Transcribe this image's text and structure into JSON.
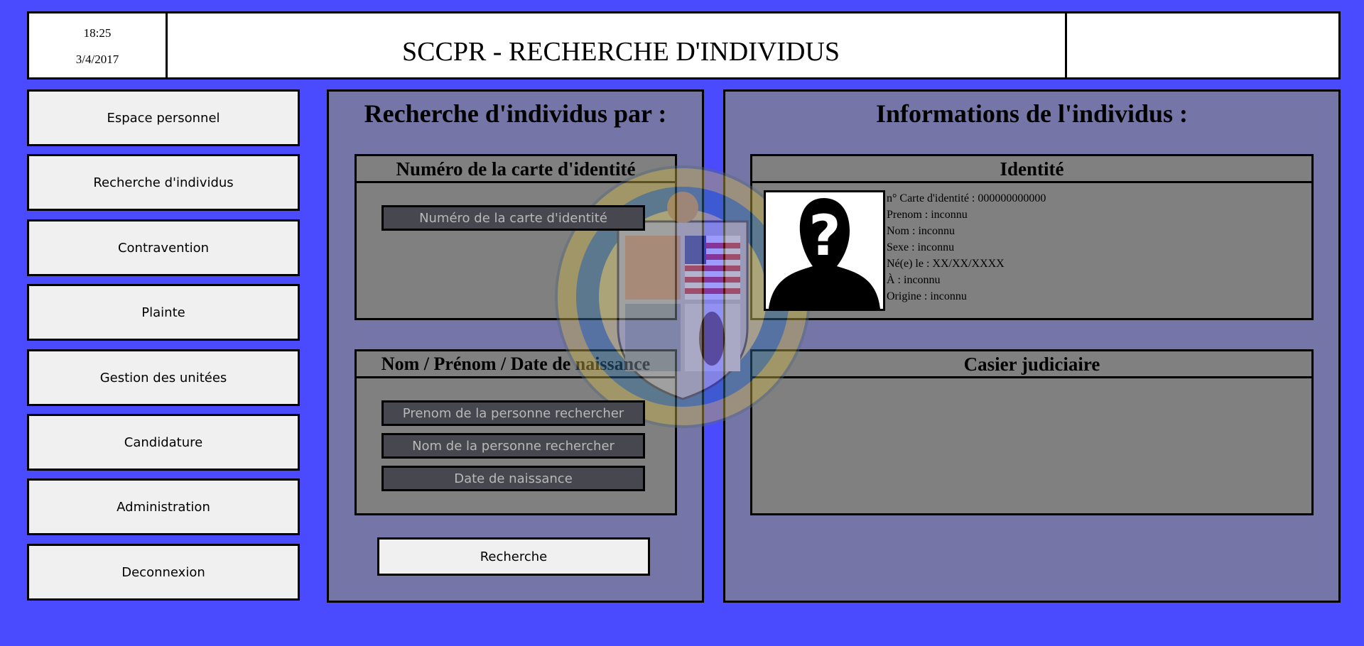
{
  "header": {
    "time": "18:25",
    "date": "3/4/2017",
    "title": "SCCPR - RECHERCHE D'INDIVIDUS"
  },
  "sidebar": {
    "items": [
      {
        "label": "Espace personnel"
      },
      {
        "label": "Recherche d'individus"
      },
      {
        "label": "Contravention"
      },
      {
        "label": "Plainte"
      },
      {
        "label": "Gestion des unitées"
      },
      {
        "label": "Candidature"
      },
      {
        "label": "Administration"
      },
      {
        "label": "Deconnexion"
      }
    ]
  },
  "search": {
    "title": "Recherche d'individus par :",
    "id_card": {
      "heading": "Numéro de la carte d'identité",
      "placeholder": "Numéro de la carte d'identité"
    },
    "name_section": {
      "heading": "Nom / Prénom / Date de naissance",
      "firstname_placeholder": "Prenom de la personne rechercher",
      "lastname_placeholder": "Nom de la personne rechercher",
      "birthdate_placeholder": "Date de naissance"
    },
    "button_label": "Recherche"
  },
  "info": {
    "title": "Informations de l'individus :",
    "identity": {
      "heading": "Identité",
      "avatar_icon": "unknown-person-icon",
      "lines": [
        "n° Carte d'identité : 000000000000",
        "Prenom : inconnu",
        "Nom : inconnu",
        "Sexe : inconnu",
        "Né(e) le : XX/XX/XXXX",
        "À : inconnu",
        "Origine : inconnu"
      ]
    },
    "record": {
      "heading": "Casier judiciaire"
    }
  },
  "colors": {
    "background": "#4a4aff",
    "panel": "#7575a8",
    "subpanel": "#808080",
    "field": "#474750",
    "button": "#f0f0f0"
  }
}
